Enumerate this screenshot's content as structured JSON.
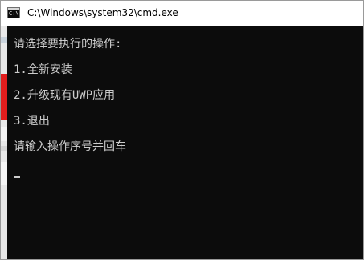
{
  "window": {
    "title": "C:\\Windows\\system32\\cmd.exe",
    "icon": "cmd-icon"
  },
  "console": {
    "lines": [
      "请选择要执行的操作:",
      "1.全新安装",
      "2.升级现有UWP应用",
      "3.退出",
      "请输入操作序号并回车"
    ],
    "background": "#0c0c0c",
    "foreground": "#cccccc"
  }
}
